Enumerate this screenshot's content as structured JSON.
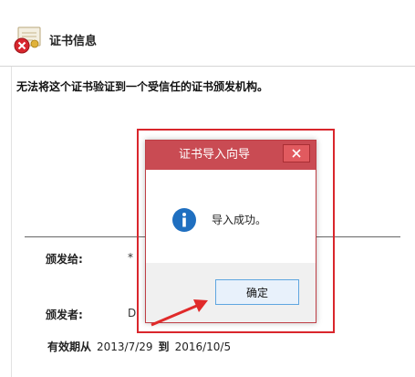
{
  "certificate": {
    "title": "证书信息",
    "warning": "无法将这个证书验证到一个受信任的证书颁发机构。",
    "issued_to_label": "颁发给:",
    "issued_to_value": "*",
    "issued_by_label": "颁发者:",
    "issued_by_value": "Di",
    "validity_label": "有效期从",
    "valid_from": "2013/7/29",
    "to_label": "到",
    "valid_to": "2016/10/5"
  },
  "dialog": {
    "title": "证书导入向导",
    "message": "导入成功。",
    "ok_label": "确定"
  },
  "colors": {
    "titlebar": "#c94b53",
    "highlight": "#d9262c",
    "arrow": "#e02a2a",
    "info_icon": "#1f6fc0"
  }
}
